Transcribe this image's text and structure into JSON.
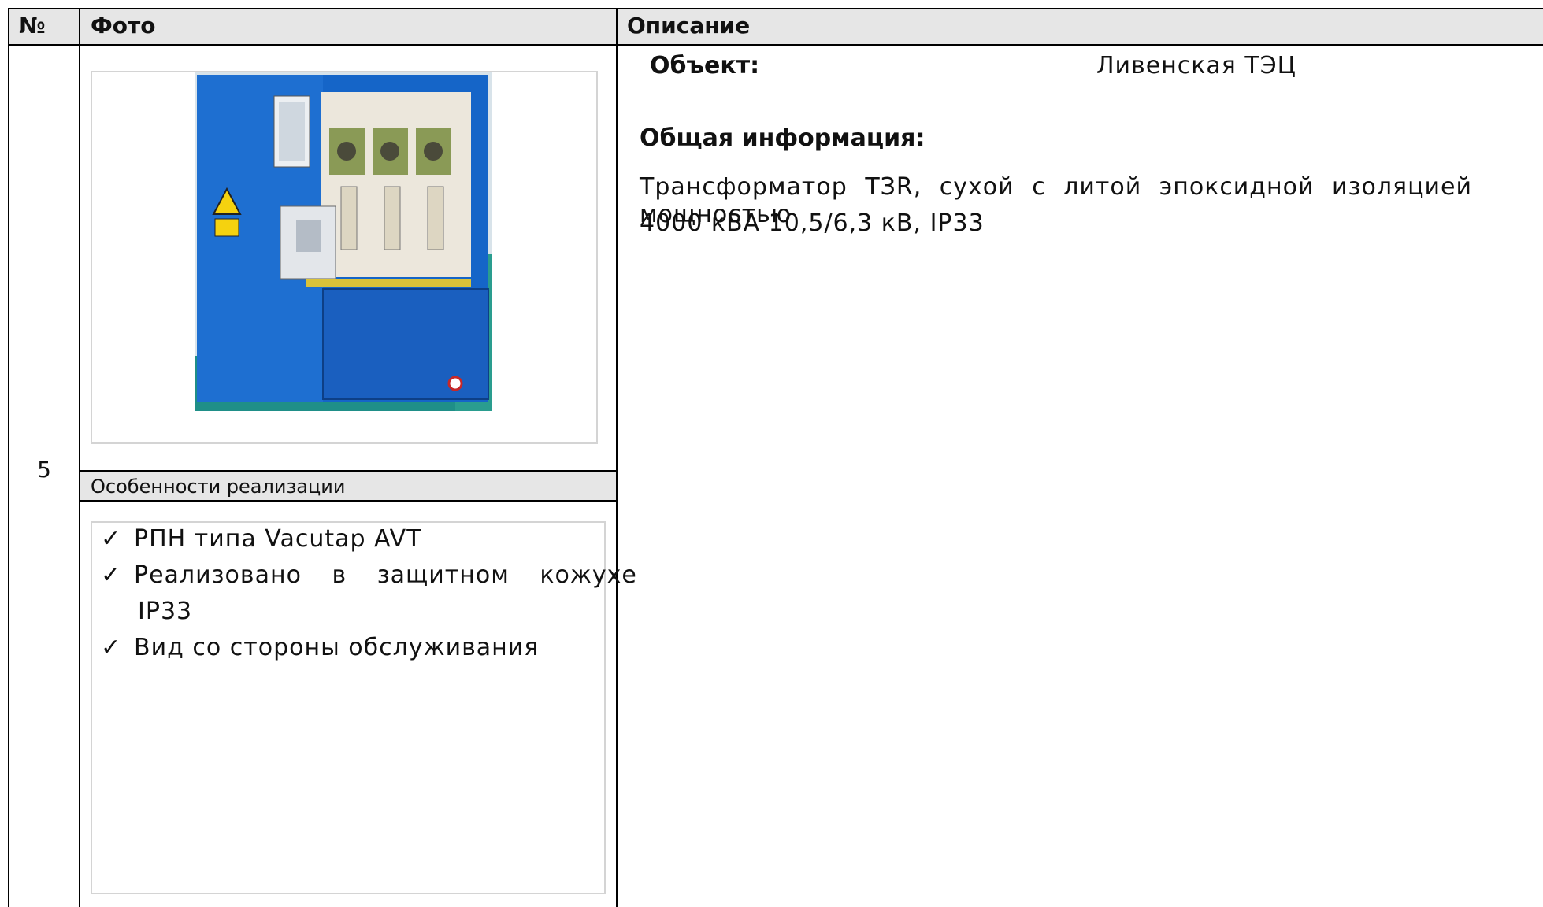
{
  "header": {
    "num": "№",
    "photo": "Фото",
    "description": "Описание"
  },
  "row": {
    "number": "5",
    "photo_alt": "blue transformer enclosure",
    "features_title": "Особенности реализации",
    "features": [
      "РПН типа Vacutap AVT",
      "Реализовано в защитном кожухе",
      "IP33",
      "Вид со стороны обслуживания"
    ],
    "object_label": "Объект:",
    "object_value": "Ливенская ТЭЦ",
    "general_label": "Общая информация:",
    "description_lines": [
      "Трансформатор ТЗR, сухой с литой эпоксидной изоляцией мощностью",
      "4000 кВА 10,5/6,3 кВ, IP33"
    ]
  },
  "icons": {
    "check": "✓"
  }
}
